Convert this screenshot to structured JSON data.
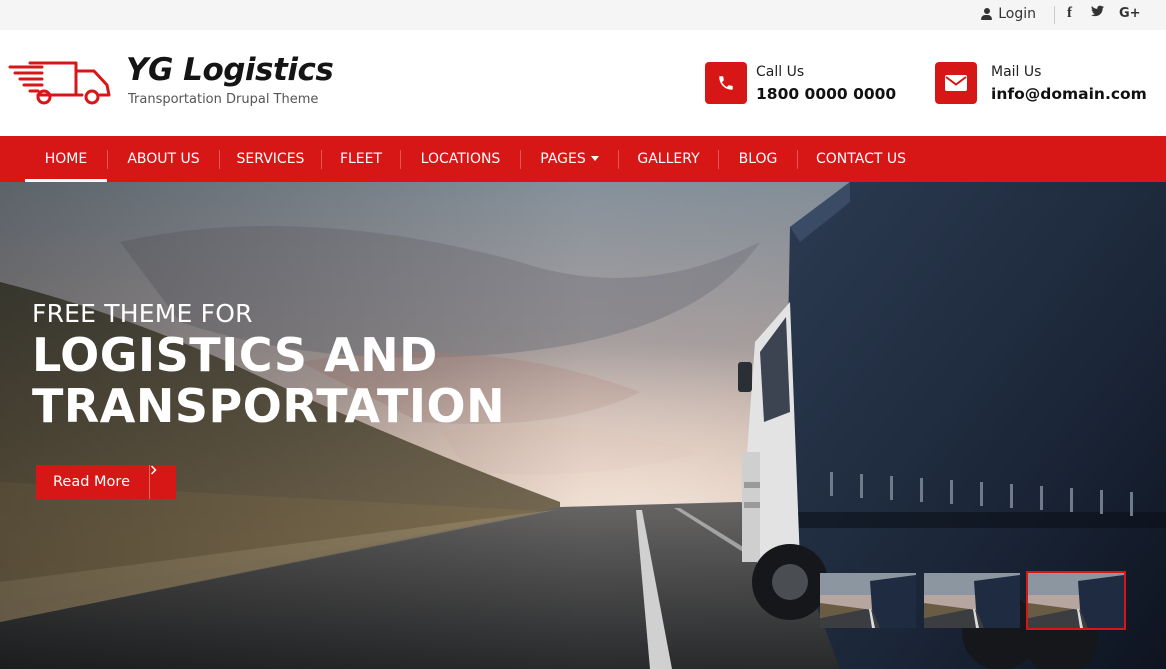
{
  "topbar": {
    "login_label": "Login",
    "social": {
      "facebook": "f",
      "twitter": "t",
      "googleplus": "G+"
    }
  },
  "header": {
    "brand": "YG Logistics",
    "tagline": "Transportation Drupal Theme",
    "call": {
      "label": "Call Us",
      "value": "1800 0000 0000"
    },
    "mail": {
      "label": "Mail Us",
      "value": "info@domain.com"
    }
  },
  "nav": {
    "items": [
      {
        "label": "HOME",
        "active": true
      },
      {
        "label": "ABOUT US"
      },
      {
        "label": "SERVICES"
      },
      {
        "label": "FLEET"
      },
      {
        "label": "LOCATIONS"
      },
      {
        "label": "PAGES",
        "has_dropdown": true
      },
      {
        "label": "GALLERY"
      },
      {
        "label": "BLOG"
      },
      {
        "label": "CONTACT US"
      }
    ]
  },
  "hero": {
    "kicker": "FREE THEME FOR",
    "headline_line1": "LOGISTICS AND",
    "headline_line2": "TRANSPORTATION",
    "cta_label": "Read More",
    "thumbnails": {
      "count": 3,
      "active_index": 2
    }
  },
  "colors": {
    "accent": "#d71616",
    "topbar_bg": "#f5f5f5"
  }
}
